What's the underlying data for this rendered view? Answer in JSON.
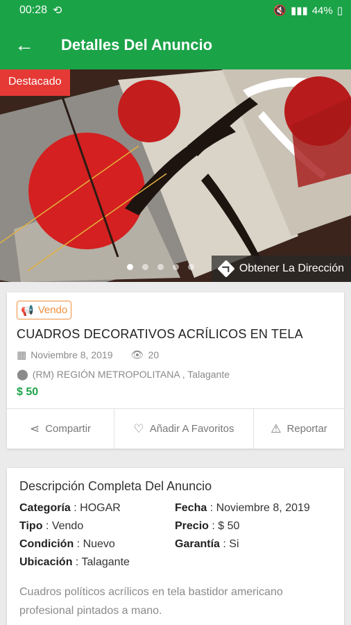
{
  "status": {
    "time": "00:28",
    "battery": "44%"
  },
  "appbar": {
    "title": "Detalles Del Anuncio"
  },
  "hero": {
    "badge": "Destacado",
    "directions": "Obtener La Dirección",
    "slide_count": 5,
    "active_slide": 1
  },
  "ad": {
    "tag": "Vendo",
    "title": "CUADROS DECORATIVOS ACRÍLICOS EN TELA",
    "date": "Noviembre 8, 2019",
    "views": "20",
    "location": "(RM) REGIÓN METROPOLITANA , Talagante",
    "price": "$ 50"
  },
  "actions": {
    "share": "Compartir",
    "favorite": "Añadir A Favoritos",
    "report": "Reportar"
  },
  "details": {
    "title": "Descripción Completa Del Anuncio",
    "category_label": "Categoría",
    "category_value": ": HOGAR",
    "date_label": "Fecha",
    "date_value": ": Noviembre 8, 2019",
    "type_label": "Tipo",
    "type_value": ": Vendo",
    "price_label": "Precio",
    "price_value": ": $ 50",
    "condition_label": "Condición",
    "condition_value": ": Nuevo",
    "warranty_label": "Garantía",
    "warranty_value": ": Si",
    "location_label": "Ubicación",
    "location_value": ": Talagante",
    "description": "Cuadros políticos acrílicos en tela bastidor americano profesional pintados a mano."
  },
  "colors": {
    "primary": "#1ba348",
    "badge": "#e53935",
    "tag": "#ef8f3b"
  }
}
